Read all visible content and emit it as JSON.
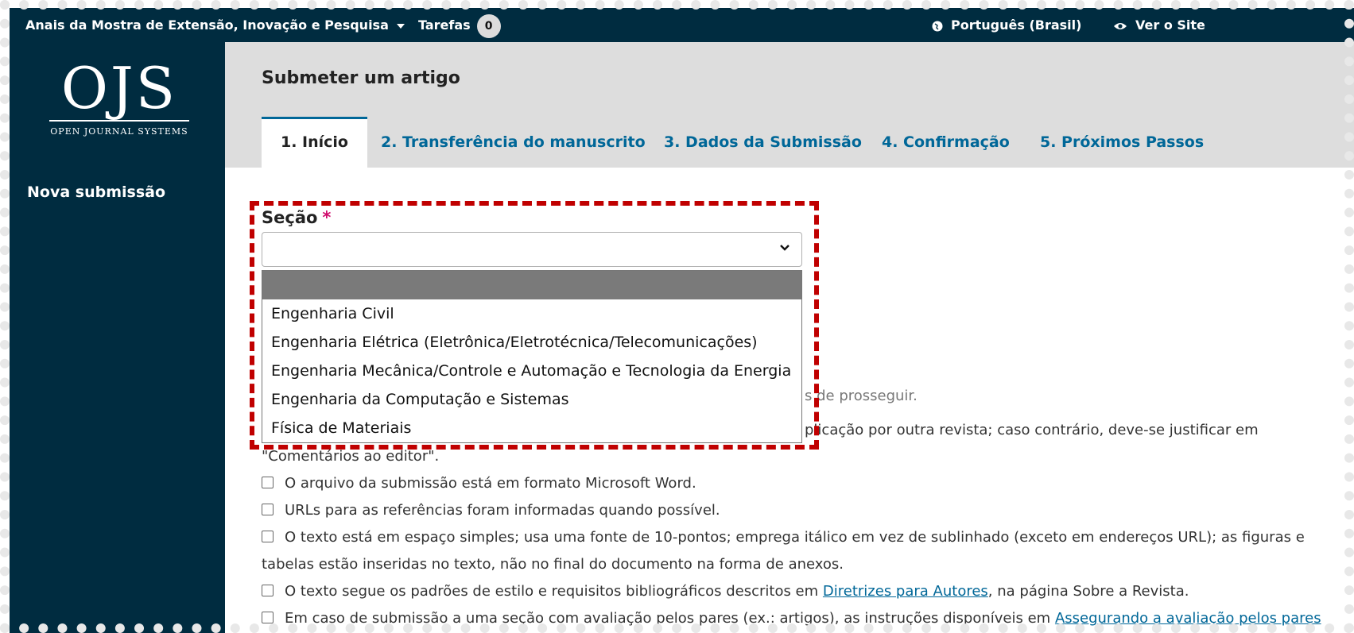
{
  "topbar": {
    "journal": "Anais da Mostra de Extensão, Inovação e Pesquisa",
    "tasks_label": "Tarefas",
    "tasks_count": "0",
    "language": "Português (Brasil)",
    "view_site": "Ver o Site"
  },
  "sidebar": {
    "logo_big": "OJS",
    "logo_small": "OPEN JOURNAL SYSTEMS",
    "nav_new": "Nova submissão"
  },
  "header": {
    "title": "Submeter um artigo",
    "tabs": [
      {
        "label": "1. Início"
      },
      {
        "label": "2. Transferência do manuscrito"
      },
      {
        "label": "3. Dados da Submissão"
      },
      {
        "label": "4. Confirmação"
      },
      {
        "label": "5. Próximos Passos"
      }
    ]
  },
  "form": {
    "section_label": "Seção",
    "required_mark": "*",
    "select_value": "",
    "options": [
      "Engenharia Civil",
      "Engenharia Elétrica (Eletrônica/Eletrotécnica/Telecomunicações)",
      "Engenharia Mecânica/Controle e Automação e Tecnologia da Energia",
      "Engenharia da Computação e Sistemas",
      "Física de Materiais"
    ]
  },
  "requirements": {
    "intro_fragment": "s de prosseguir.",
    "item1_fragment": "plicação por outra revista; caso contrário, deve-se justificar em",
    "item1_cont": "\"Comentários ao editor\".",
    "item2": "O arquivo da submissão está em formato Microsoft Word.",
    "item3": "URLs para as referências foram informadas quando possível.",
    "item4": "O texto está em espaço simples; usa uma fonte de 10-pontos; emprega itálico em vez de sublinhado (exceto em endereços URL); as figuras e",
    "item4_cont": "tabelas estão inseridas no texto, não no final do documento na forma de anexos.",
    "item5_pre": "O texto segue os padrões de estilo e requisitos bibliográficos descritos em",
    "item5_link": "Diretrizes para Autores",
    "item5_post": ", na página Sobre a Revista.",
    "item6_pre": "Em caso de submissão a uma seção com avaliação pelos pares (ex.: artigos), as instruções disponíveis em",
    "item6_link": "Assegurando a avaliação pelos pares"
  },
  "colors": {
    "dark_navy": "#002c40",
    "link_blue": "#006798",
    "annotation_red": "#c00000",
    "required_magenta": "#d00b6c"
  }
}
